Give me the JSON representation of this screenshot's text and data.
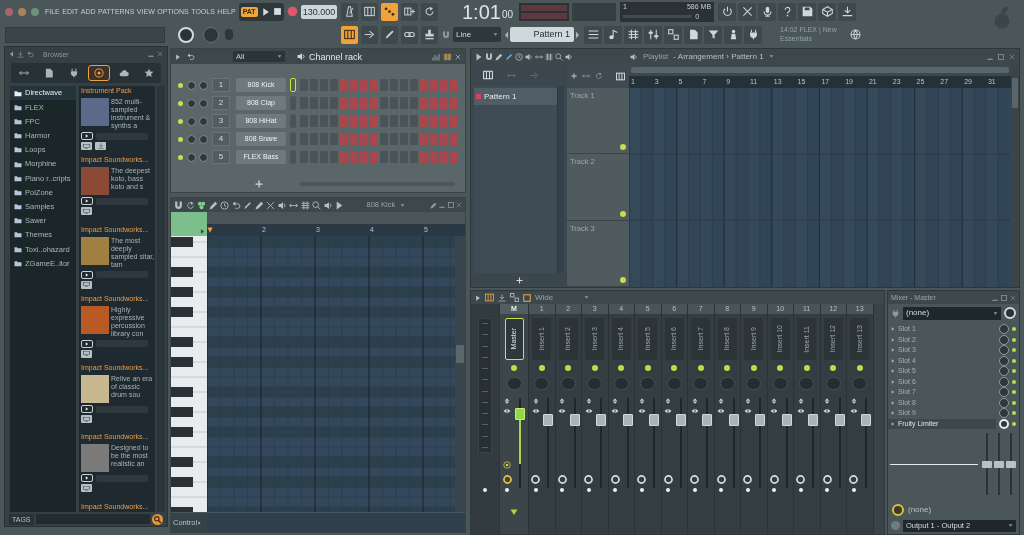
{
  "top_bar": {
    "menu": [
      "FILE",
      "EDIT",
      "ADD",
      "PATTERNS",
      "VIEW",
      "OPTIONS",
      "TOOLS",
      "HELP"
    ],
    "mode": "PAT",
    "tempo": "130.000",
    "toggles": [
      {
        "on": false
      },
      {
        "on": false
      },
      {
        "on": true
      },
      {
        "on": false
      },
      {
        "on": false
      }
    ],
    "time": "1:01",
    "time_ticks": "00",
    "cpu": "1",
    "memory": "586 MB",
    "polyphony": "0",
    "tools": [
      {
        "on": true
      },
      {
        "on": false
      },
      {
        "on": false
      },
      {
        "on": false
      },
      {
        "on": false
      }
    ],
    "snap": "Line",
    "pattern": "Pattern 1",
    "news": "14:02 FLEX | New Essentials"
  },
  "browser": {
    "title": "Browser",
    "tabs": [
      {
        "selected": false
      },
      {
        "selected": false
      },
      {
        "selected": false
      },
      {
        "selected": true
      },
      {
        "selected": false
      },
      {
        "selected": false
      }
    ],
    "folders": [
      {
        "name": "Directwave",
        "selected": true
      },
      {
        "name": "FLEX",
        "selected": false
      },
      {
        "name": "FPC",
        "selected": false
      },
      {
        "name": "Harmor",
        "selected": false
      },
      {
        "name": "Loops",
        "selected": false
      },
      {
        "name": "Morphine",
        "selected": false
      },
      {
        "name": "Piano r..cripts",
        "selected": false
      },
      {
        "name": "PoiZone",
        "selected": false
      },
      {
        "name": "Samples",
        "selected": false
      },
      {
        "name": "Sawer",
        "selected": false
      },
      {
        "name": "Themes",
        "selected": false
      },
      {
        "name": "Toxi..ohazard",
        "selected": false
      },
      {
        "name": "ZGameE..itor",
        "selected": false
      }
    ],
    "packs": [
      {
        "title": "Instrument Pack",
        "description": "852 multi-sampled instrument & synths a",
        "downloadable": true
      },
      {
        "title": "Impact Soundworks...",
        "description": "The deepest koto, bass koto and s",
        "downloadable": false
      },
      {
        "title": "Impact Soundworks...",
        "description": "The most deeply sampled sitar, tam",
        "downloadable": false
      },
      {
        "title": "Impact Soundworks...",
        "description": "Highly expressive percussion library con",
        "downloadable": false
      },
      {
        "title": "Impact Soundworks...",
        "description": "Relive an era of classic drum sou",
        "downloadable": false
      },
      {
        "title": "Impact Soundworks...",
        "description": "Designed to be the most realistic an",
        "downloadable": false
      },
      {
        "title": "Impact Soundworks..."
      }
    ],
    "tags": "TAGS"
  },
  "channel_rack": {
    "filter": "All",
    "title": "Channel rack",
    "channels": [
      {
        "number": "1",
        "name": "808 Kick",
        "selected": true
      },
      {
        "number": "2",
        "name": "808 Clap",
        "selected": false
      },
      {
        "number": "3",
        "name": "808 HiHat",
        "selected": false
      },
      {
        "number": "4",
        "name": "808 Snare",
        "selected": false
      },
      {
        "number": "5",
        "name": "FLEX Bass",
        "selected": false
      }
    ]
  },
  "piano_roll": {
    "channel": "808 Kick",
    "bars": [
      "2",
      "3",
      "4",
      "5"
    ],
    "lane": "Control"
  },
  "playlist": {
    "title": "Playlist",
    "breadcrumb": "- Arrangement › Pattern 1",
    "patterns": [
      {
        "name": "Pattern 1",
        "selected": true,
        "color": "#d2445a"
      }
    ],
    "tracks": [
      {
        "name": "Track 1"
      },
      {
        "name": "Track 2"
      },
      {
        "name": "Track 3"
      }
    ],
    "bars": [
      "1",
      "3",
      "5",
      "7",
      "9",
      "11",
      "13",
      "15",
      "17",
      "19",
      "21",
      "23",
      "25",
      "27",
      "29",
      "31"
    ]
  },
  "mixer": {
    "mode": "Wide",
    "tracks": [
      {
        "number": "M",
        "name": "Master",
        "kind": "master",
        "level": 0.87
      },
      {
        "number": "1",
        "name": "Insert 1",
        "kind": "insert",
        "level": 0.8
      },
      {
        "number": "2",
        "name": "Insert 2",
        "kind": "insert",
        "level": 0.8
      },
      {
        "number": "3",
        "name": "Insert 3",
        "kind": "insert",
        "level": 0.8
      },
      {
        "number": "4",
        "name": "Insert 4",
        "kind": "insert",
        "level": 0.8
      },
      {
        "number": "5",
        "name": "Insert 5",
        "kind": "insert",
        "level": 0.8
      },
      {
        "number": "6",
        "name": "Insert 6",
        "kind": "insert",
        "level": 0.8
      },
      {
        "number": "7",
        "name": "Insert 7",
        "kind": "insert",
        "level": 0.8
      },
      {
        "number": "8",
        "name": "Insert 8",
        "kind": "insert",
        "level": 0.8
      },
      {
        "number": "9",
        "name": "Insert 9",
        "kind": "insert",
        "level": 0.8
      },
      {
        "number": "10",
        "name": "Insert 10",
        "kind": "insert",
        "level": 0.8
      },
      {
        "number": "11",
        "name": "Insert 11",
        "kind": "insert",
        "level": 0.8
      },
      {
        "number": "12",
        "name": "Insert 12",
        "kind": "insert",
        "level": 0.8
      },
      {
        "number": "13",
        "name": "Insert 13",
        "kind": "insert",
        "level": 0.8
      }
    ]
  },
  "mixer_panel": {
    "title": "Mixer - Master",
    "input": "(none)",
    "slots": [
      {
        "name": "Slot 1",
        "loaded": false
      },
      {
        "name": "Slot 2",
        "loaded": false
      },
      {
        "name": "Slot 3",
        "loaded": false
      },
      {
        "name": "Slot 4",
        "loaded": false
      },
      {
        "name": "Slot 5",
        "loaded": false
      },
      {
        "name": "Slot 6",
        "loaded": false
      },
      {
        "name": "Slot 7",
        "loaded": false
      },
      {
        "name": "Slot 8",
        "loaded": false
      },
      {
        "name": "Slot 9",
        "loaded": false
      },
      {
        "name": "Fruity Limiter",
        "loaded": true
      }
    ],
    "eq_bands": [
      {
        "level": 0.5
      },
      {
        "level": 0.5
      },
      {
        "level": 0.5
      }
    ],
    "sidechain": "(none)",
    "output": "Output 1 - Output 2"
  }
}
